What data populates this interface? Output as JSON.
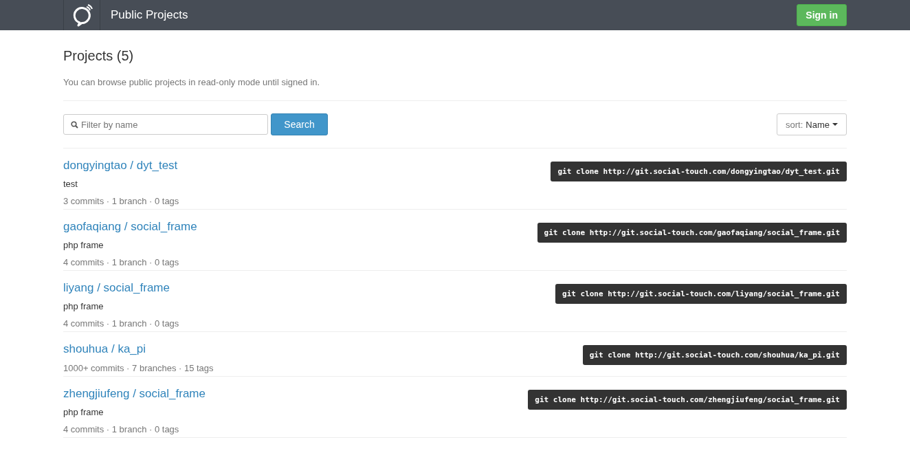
{
  "header": {
    "title": "Public Projects",
    "sign_in": "Sign in"
  },
  "page": {
    "heading": "Projects (5)",
    "note": "You can browse public projects in read-only mode until signed in."
  },
  "filter": {
    "placeholder": "Filter by name",
    "search": "Search",
    "sort_label": "sort:",
    "sort_value": "Name"
  },
  "projects": [
    {
      "title": "dongyingtao / dyt_test",
      "description": "test",
      "stats": "3 commits · 1 branch · 0 tags",
      "clone": "git clone http://git.social-touch.com/dongyingtao/dyt_test.git"
    },
    {
      "title": "gaofaqiang / social_frame",
      "description": "php frame",
      "stats": "4 commits · 1 branch · 0 tags",
      "clone": "git clone http://git.social-touch.com/gaofaqiang/social_frame.git"
    },
    {
      "title": "liyang / social_frame",
      "description": "php frame",
      "stats": "4 commits · 1 branch · 0 tags",
      "clone": "git clone http://git.social-touch.com/liyang/social_frame.git"
    },
    {
      "title": "shouhua / ka_pi",
      "stats": "1000+ commits · 7 branches · 15 tags",
      "clone": "git clone http://git.social-touch.com/shouhua/ka_pi.git"
    },
    {
      "title": "zhengjiufeng / social_frame",
      "description": "php frame",
      "stats": "4 commits · 1 branch · 0 tags",
      "clone": "git clone http://git.social-touch.com/zhengjiufeng/social_frame.git"
    }
  ]
}
